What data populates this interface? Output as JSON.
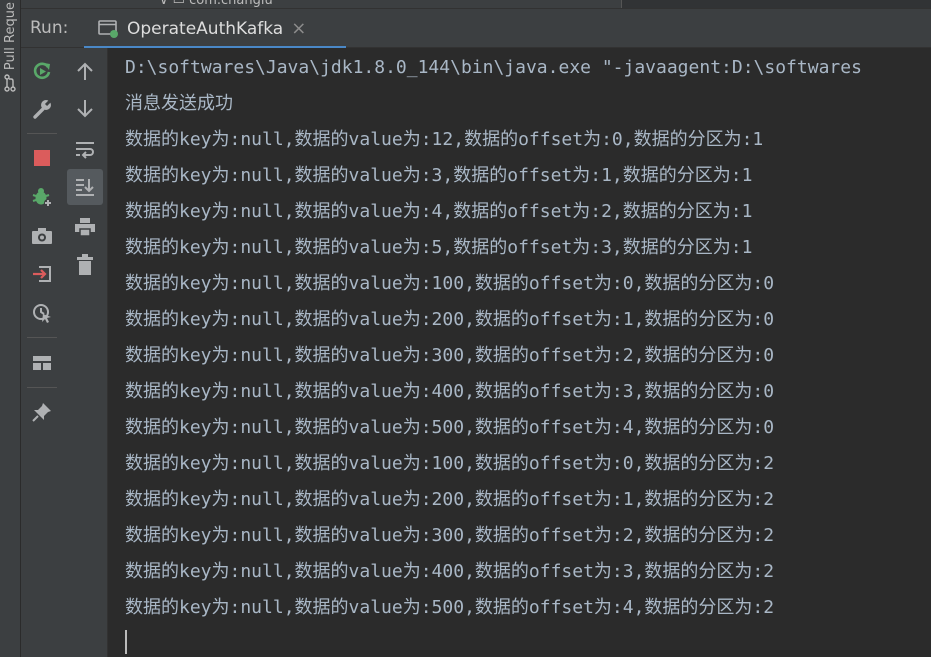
{
  "side_tab": {
    "label": "Pull Reque"
  },
  "background_tree": {
    "text": "com.changlu"
  },
  "run_panel": {
    "label": "Run:",
    "tab": {
      "label": "OperateAuthKafka",
      "close": "×"
    }
  },
  "toolbar_primary": [
    "rerun-icon",
    "settings-wrench-icon",
    "stop-icon",
    "debug-icon",
    "camera-icon",
    "login-icon",
    "attach-debugger-icon",
    "layout-icon",
    "pin-icon"
  ],
  "toolbar_secondary": [
    "up-arrow-icon",
    "down-arrow-icon",
    "soft-wrap-icon",
    "scroll-to-end-icon",
    "print-icon",
    "trash-icon"
  ],
  "console": {
    "command": "D:\\softwares\\Java\\jdk1.8.0_144\\bin\\java.exe \"-javaagent:D:\\softwares",
    "lines": [
      "消息发送成功",
      "数据的key为:null,数据的value为:12,数据的offset为:0,数据的分区为:1",
      "数据的key为:null,数据的value为:3,数据的offset为:1,数据的分区为:1",
      "数据的key为:null,数据的value为:4,数据的offset为:2,数据的分区为:1",
      "数据的key为:null,数据的value为:5,数据的offset为:3,数据的分区为:1",
      "数据的key为:null,数据的value为:100,数据的offset为:0,数据的分区为:0",
      "数据的key为:null,数据的value为:200,数据的offset为:1,数据的分区为:0",
      "数据的key为:null,数据的value为:300,数据的offset为:2,数据的分区为:0",
      "数据的key为:null,数据的value为:400,数据的offset为:3,数据的分区为:0",
      "数据的key为:null,数据的value为:500,数据的offset为:4,数据的分区为:0",
      "数据的key为:null,数据的value为:100,数据的offset为:0,数据的分区为:2",
      "数据的key为:null,数据的value为:200,数据的offset为:1,数据的分区为:2",
      "数据的key为:null,数据的value为:300,数据的offset为:2,数据的分区为:2",
      "数据的key为:null,数据的value为:400,数据的offset为:3,数据的分区为:2",
      "数据的key为:null,数据的value为:500,数据的offset为:4,数据的分区为:2"
    ]
  },
  "colors": {
    "background": "#2b2b2b",
    "panel": "#3c3f41",
    "console_text": "#a9b7c6",
    "accent_tab": "#4a88c7",
    "rerun_green": "#59a869",
    "stop_red": "#db5c5c"
  }
}
